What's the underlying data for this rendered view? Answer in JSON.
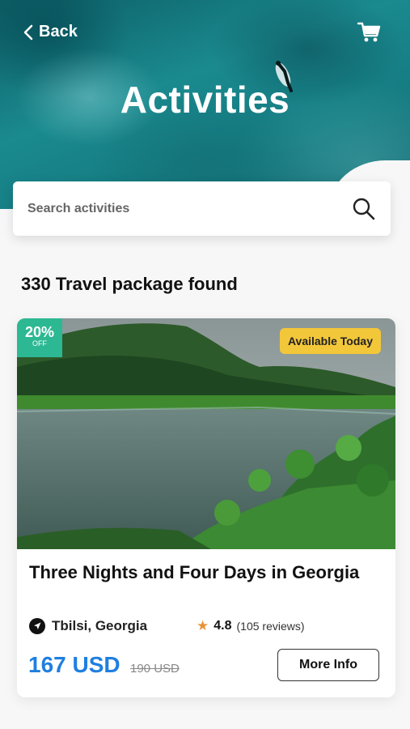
{
  "header": {
    "back_label": "Back",
    "title": "Activities",
    "icons": [
      "chevron-left-icon",
      "cart-icon",
      "search-icon"
    ]
  },
  "search": {
    "placeholder": "Search activities",
    "value": ""
  },
  "results": {
    "count_label": "330 Travel package found"
  },
  "card": {
    "discount_pct": "20%",
    "discount_off": "OFF",
    "availability": "Available Today",
    "title": "Three Nights and Four Days in Georgia",
    "location": "Tbilsi, Georgia",
    "rating": "4.8",
    "reviews": "(105 reviews)",
    "price": "167 USD",
    "old_price": "190 USD",
    "more_label": "More Info"
  },
  "colors": {
    "accent_blue": "#1f7fe0",
    "discount_green": "#2cb893",
    "badge_yellow": "#f3c73a",
    "star_orange": "#e8923a"
  }
}
